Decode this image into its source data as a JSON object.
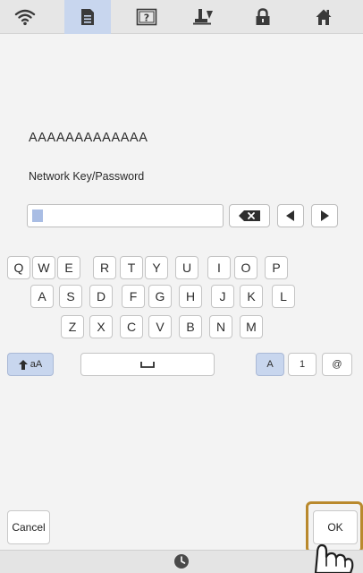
{
  "toolbar": {
    "items": [
      {
        "name": "wifi-icon"
      },
      {
        "name": "document-icon"
      },
      {
        "name": "help-icon",
        "label": "?"
      },
      {
        "name": "presser-foot-icon"
      },
      {
        "name": "lock-icon"
      },
      {
        "name": "home-icon"
      }
    ],
    "active_index": 1,
    "active_color": "#c8d6ee"
  },
  "network": {
    "ssid": "AAAAAAAAAAAAA",
    "field_label": "Network Key/Password",
    "password_value": ""
  },
  "keyboard": {
    "row1": [
      "Q",
      "W",
      "E",
      "R",
      "T",
      "Y",
      "U",
      "I",
      "O",
      "P"
    ],
    "row2": [
      "A",
      "S",
      "D",
      "F",
      "G",
      "H",
      "J",
      "K",
      "L"
    ],
    "row3": [
      "Z",
      "X",
      "C",
      "V",
      "B",
      "N",
      "M"
    ],
    "shift_label": "aA",
    "mode_keys": [
      "A",
      "1",
      "@"
    ],
    "selected_mode": "A"
  },
  "buttons": {
    "cancel": "Cancel",
    "ok": "OK"
  },
  "colors": {
    "highlight": "#c8d6ee",
    "ok_frame": "#b9892d"
  }
}
